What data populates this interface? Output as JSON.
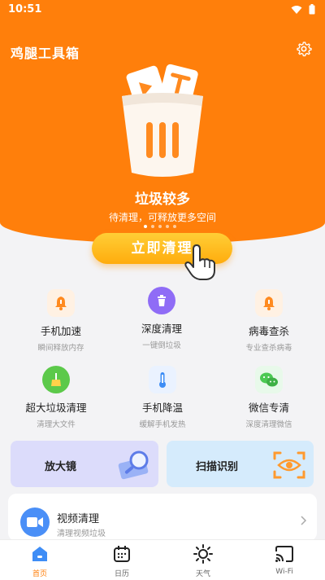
{
  "status_bar": {
    "time": "10:51"
  },
  "header": {
    "title": "鸡腿工具箱"
  },
  "hero": {
    "title": "垃圾较多",
    "subtitle": "待清理，可释放更多空间",
    "clean_button": "立即清理"
  },
  "features": [
    {
      "name": "手机加速",
      "desc": "瞬间释放内存",
      "icon": "bell-icon",
      "color": "#ff8a1f"
    },
    {
      "name": "深度清理",
      "desc": "一键倒垃圾",
      "icon": "trash-icon",
      "color": "#8f6cf6"
    },
    {
      "name": "病毒查杀",
      "desc": "专业查杀病毒",
      "icon": "bell-icon",
      "color": "#ff8a1f"
    },
    {
      "name": "超大垃圾清理",
      "desc": "清理大文件",
      "icon": "broom-icon",
      "color": "#5cc94a"
    },
    {
      "name": "手机降温",
      "desc": "缓解手机发热",
      "icon": "thermometer-icon",
      "color": "#3d8df5"
    },
    {
      "name": "微信专清",
      "desc": "深度清理微信",
      "icon": "wechat-icon",
      "color": "#4cc953"
    }
  ],
  "cards": [
    {
      "label": "放大镜",
      "bg": "#dcdcfb"
    },
    {
      "label": "扫描识别",
      "bg": "#d5ebfc"
    }
  ],
  "video_clean": {
    "title": "视频清理",
    "subtitle": "清理视频垃圾"
  },
  "tabs": [
    {
      "label": "首页"
    },
    {
      "label": "日历"
    },
    {
      "label": "天气"
    },
    {
      "label": "Wi-Fi"
    }
  ],
  "colors": {
    "brand": "#ff7f0b",
    "button": "#ffb312"
  }
}
